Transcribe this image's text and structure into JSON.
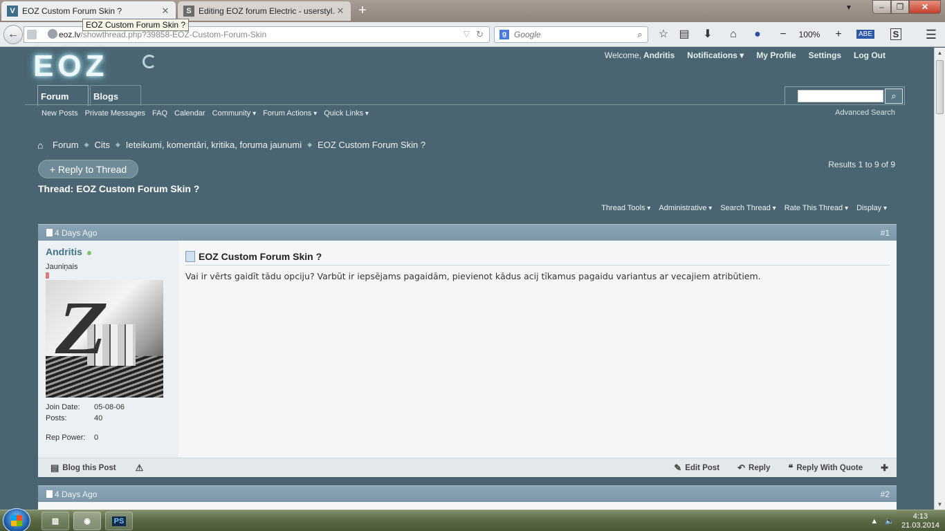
{
  "browser": {
    "tabs": [
      {
        "title": "EOZ Custom Forum Skin ?",
        "favicon": "V",
        "favicon_color": "#3e6f8a"
      },
      {
        "title": "Editing EOZ forum Electric - userstyl...",
        "favicon": "S",
        "favicon_color": "#6a6a6a"
      }
    ],
    "tooltip": "EOZ Custom Forum Skin ?",
    "url_host": "eoz.lv",
    "url_path": "/showthread.php?39858-EOZ-Custom-Forum-Skin",
    "search_placeholder": "Google",
    "zoom": "100%",
    "icons": [
      "back-icon",
      "star-icon",
      "reader-icon",
      "download-icon",
      "home-icon",
      "addon-icon",
      "zoom-out-icon",
      "zoom-in-icon",
      "abe-icon",
      "stylish-icon",
      "menu-icon"
    ]
  },
  "site": {
    "logo": "EOZ",
    "welcome": "Welcome,",
    "user": "Andritis",
    "notifications": "Notifications",
    "my_profile": "My Profile",
    "settings": "Settings",
    "logout": "Log Out",
    "tabs": [
      "Forum",
      "Blogs"
    ],
    "subnav": [
      "New Posts",
      "Private Messages",
      "FAQ",
      "Calendar",
      "Community",
      "Forum Actions",
      "Quick Links"
    ],
    "advanced_search": "Advanced Search",
    "breadcrumb": [
      "Forum",
      "Cits",
      "Ieteikumi, komentāri, kritika, foruma jaunumi",
      "EOZ Custom Forum Skin ?"
    ],
    "reply_to_thread": "+ Reply to Thread",
    "results": "Results 1 to 9 of 9",
    "thread_title": "Thread: EOZ Custom Forum Skin ?",
    "thread_tools": [
      "Thread Tools",
      "Administrative",
      "Search Thread",
      "Rate This Thread",
      "Display"
    ]
  },
  "posts": [
    {
      "date": "4 Days Ago",
      "number": "#1",
      "username": "Andritis",
      "usertitle": "Jauniņais",
      "join_date_label": "Join Date:",
      "join_date": "05-08-06",
      "posts_label": "Posts:",
      "posts": "40",
      "rep_label": "Rep Power:",
      "rep": "0",
      "title": "EOZ Custom Forum Skin ?",
      "text": "Vai ir vērts gaidīt tādu opciju? Varbūt ir iepsējams pagaidām, pievienot kādus acij tīkamus pagaidu variantus ar vecajiem atribūtiem.",
      "blog": "Blog this Post",
      "edit": "Edit Post",
      "reply": "Reply",
      "reply_quote": "Reply With Quote"
    },
    {
      "date": "4 Days Ago",
      "number": "#2"
    }
  ],
  "taskbar": {
    "time": "4:13",
    "date": "21.03.2014",
    "items": [
      "PS"
    ]
  }
}
